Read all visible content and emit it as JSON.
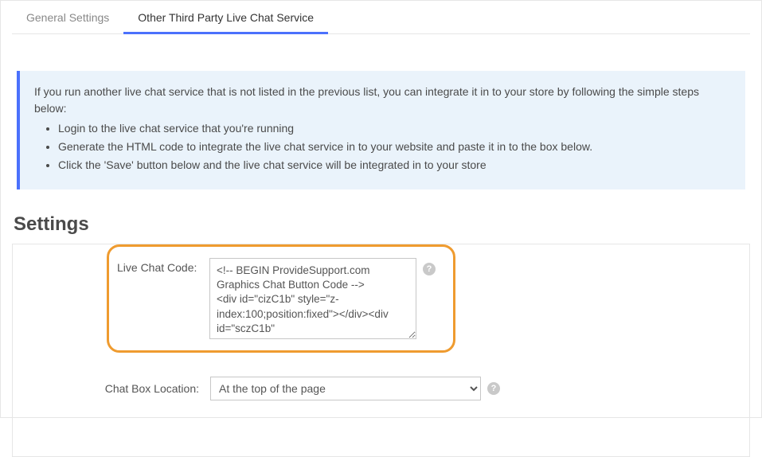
{
  "tabs": {
    "general": "General Settings",
    "other": "Other Third Party Live Chat Service"
  },
  "info": {
    "intro": "If you run another live chat service that is not listed in the previous list, you can integrate it in to your store by following the simple steps below:",
    "steps": [
      "Login to the live chat service that you're running",
      "Generate the HTML code to integrate the live chat service in to your website and paste it in to the box below.",
      "Click the 'Save' button below and the live chat service will be integrated in to your store"
    ]
  },
  "section_title": "Settings",
  "form": {
    "code_label": "Live Chat Code:",
    "code_value": "<!-- BEGIN ProvideSupport.com Graphics Chat Button Code -->\n<div id=\"cizC1b\" style=\"z-index:100;position:fixed\"></div><div id=\"sczC1b\"",
    "location_label": "Chat Box Location:",
    "location_value": "At the top of the page"
  },
  "help_glyph": "?"
}
